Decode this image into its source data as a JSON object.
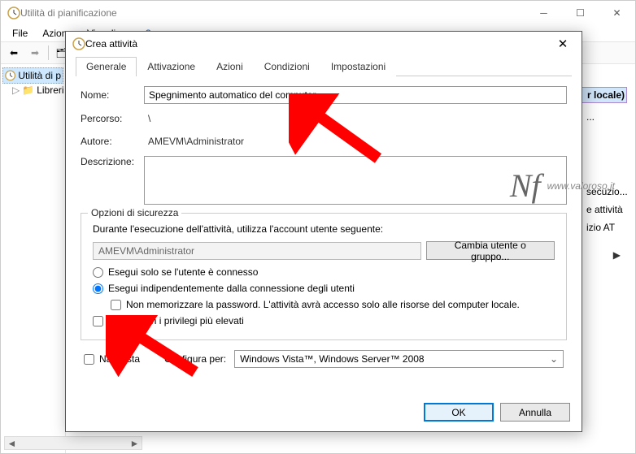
{
  "parent": {
    "title": "Utilità di pianificazione",
    "menu": {
      "file": "File",
      "azione": "Azione",
      "visualizza": "Visualizza"
    },
    "tree": {
      "root": "Utilità di p",
      "child": "Libreri"
    },
    "actions": {
      "header": "r locale)",
      "items": [
        "...",
        "secuzio...",
        "e attività",
        "izio AT"
      ]
    }
  },
  "dialog": {
    "title": "Crea attività",
    "tabs": {
      "generale": "Generale",
      "attivazione": "Attivazione",
      "azioni": "Azioni",
      "condizioni": "Condizioni",
      "impostazioni": "Impostazioni"
    },
    "labels": {
      "nome": "Nome:",
      "percorso": "Percorso:",
      "autore": "Autore:",
      "descrizione": "Descrizione:"
    },
    "values": {
      "nome": "Spegnimento automatico del computer",
      "percorso": "\\",
      "autore": "AMEVM\\Administrator"
    },
    "security": {
      "group_title": "Opzioni di sicurezza",
      "account_line": "Durante l'esecuzione dell'attività, utilizza l'account utente seguente:",
      "account_value": "AMEVM\\Administrator",
      "change_btn": "Cambia utente o gruppo...",
      "radio_connected": "Esegui solo se l'utente è connesso",
      "radio_independent": "Esegui indipendentemente dalla connessione degli utenti",
      "check_nopw": "Non memorizzare la password. L'attività avrà accesso solo alle risorse del computer locale.",
      "check_elevated": "Esegui con i privilegi più elevati"
    },
    "bottom": {
      "hidden": "Nascosta",
      "config_label": "Configura per:",
      "config_value": "Windows Vista™, Windows Server™ 2008"
    },
    "buttons": {
      "ok": "OK",
      "cancel": "Annulla"
    }
  },
  "watermark": "www.valoroso.it"
}
